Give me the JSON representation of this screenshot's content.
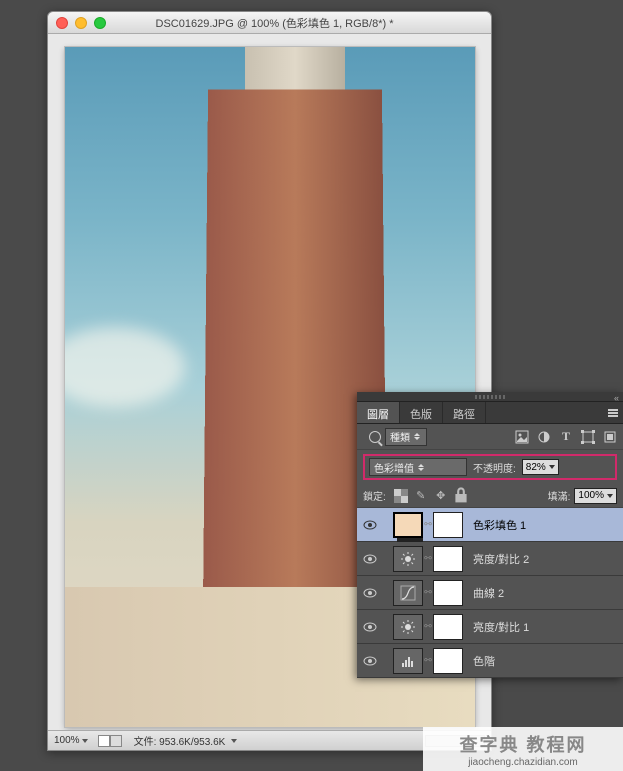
{
  "window": {
    "title": "DSC01629.JPG @ 100% (色彩填色 1, RGB/8*) *"
  },
  "statusbar": {
    "zoom": "100%",
    "filesize_label": "文件:",
    "filesize": "953.6K/953.6K"
  },
  "panel": {
    "tabs": [
      "圖層",
      "色版",
      "路徑"
    ],
    "kind_label": "種類",
    "blend_mode": "色彩增值",
    "opacity_label": "不透明度:",
    "opacity_value": "82%",
    "lock_label": "鎖定:",
    "fill_label": "填滿:",
    "fill_value": "100%",
    "layers": [
      {
        "name": "色彩填色 1",
        "type": "fill",
        "selected": true
      },
      {
        "name": "亮度/對比 2",
        "type": "brightness"
      },
      {
        "name": "曲線 2",
        "type": "curves"
      },
      {
        "name": "亮度/對比 1",
        "type": "brightness"
      },
      {
        "name": "色階",
        "type": "levels"
      }
    ]
  },
  "watermark": {
    "title": "查字典 教程网",
    "url": "jiaocheng.chazidian.com"
  }
}
